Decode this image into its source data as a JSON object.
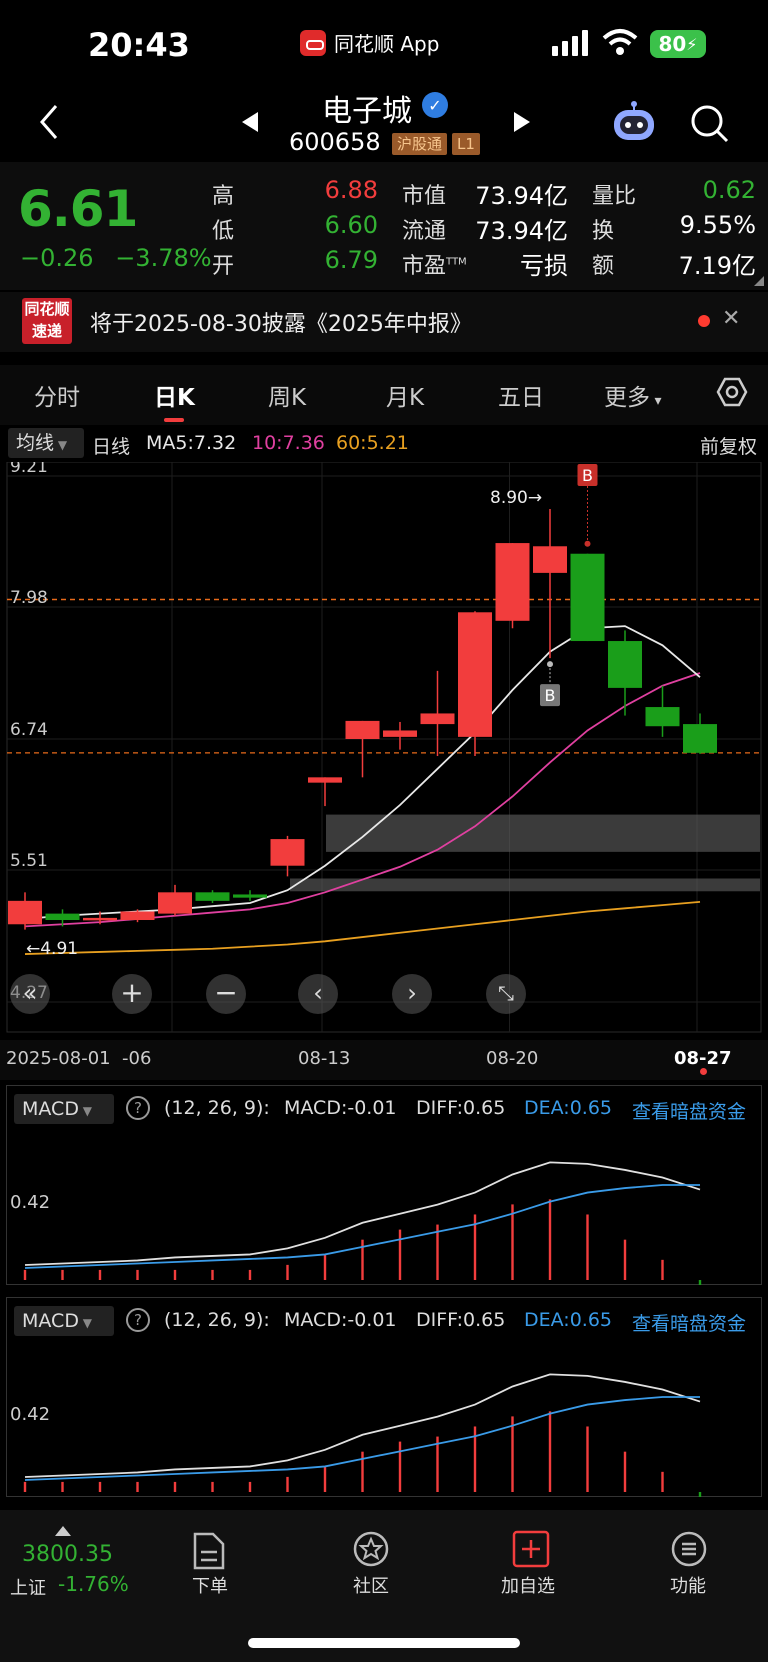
{
  "status_bar": {
    "time": "20:43",
    "app_name": "同花顺 App",
    "battery": "80"
  },
  "nav": {
    "stock_name": "电子城",
    "stock_code": "600658",
    "tag_market": "沪股通",
    "tag_level": "L1"
  },
  "quote": {
    "price": "6.61",
    "change": "−0.26",
    "change_pct": "−3.78%",
    "high_label": "高",
    "high": "6.88",
    "low_label": "低",
    "low": "6.60",
    "open_label": "开",
    "open": "6.79",
    "mktcap_label": "市值",
    "mktcap": "73.94亿",
    "float_label": "流通",
    "float": "73.94亿",
    "pe_label": "市盈",
    "pe_sup": "TTM",
    "pe": "亏损",
    "volratio_label": "量比",
    "volratio": "0.62",
    "turnover_label": "换",
    "turnover": "9.55%",
    "amount_label": "额",
    "amount": "7.19亿"
  },
  "notice": {
    "logo_line1": "同花顺",
    "logo_line2": "速递",
    "text": "将于2025-08-30披露《2025年中报》"
  },
  "tabs": [
    "分时",
    "日K",
    "周K",
    "月K",
    "五日",
    "更多"
  ],
  "active_tab": "日K",
  "chart_header": {
    "indicator": "均线",
    "period": "日线",
    "ma5": "MA5:7.32",
    "ma10": "10:7.36",
    "ma60": "60:5.21",
    "adjust": "前复权"
  },
  "chart_data": {
    "type": "candlestick",
    "y_ticks": [
      "9.21",
      "7.98",
      "6.74",
      "5.51",
      "4.27"
    ],
    "ylim": [
      4.27,
      9.21
    ],
    "x_ticks": [
      "2025-08-01",
      "-06",
      "08-13",
      "08-20",
      "08-27"
    ],
    "max_label": "8.90→",
    "min_label": "4.91",
    "buy_marker": "B",
    "colors": {
      "up": "#f23d3d",
      "down": "#1a9e1a",
      "ma5": "#e8e8e8",
      "ma10": "#e040a0",
      "ma60": "#e8a020"
    },
    "candles": [
      {
        "o": 5.0,
        "h": 5.3,
        "l": 4.95,
        "c": 5.22
      },
      {
        "o": 5.1,
        "h": 5.14,
        "l": 4.98,
        "c": 5.04
      },
      {
        "o": 5.06,
        "h": 5.12,
        "l": 5.0,
        "c": 5.06
      },
      {
        "o": 5.04,
        "h": 5.14,
        "l": 5.02,
        "c": 5.12
      },
      {
        "o": 5.1,
        "h": 5.37,
        "l": 5.08,
        "c": 5.3
      },
      {
        "o": 5.3,
        "h": 5.32,
        "l": 5.2,
        "c": 5.22
      },
      {
        "o": 5.28,
        "h": 5.32,
        "l": 5.22,
        "c": 5.25
      },
      {
        "o": 5.55,
        "h": 5.83,
        "l": 5.45,
        "c": 5.8
      },
      {
        "o": 6.33,
        "h": 6.38,
        "l": 6.11,
        "c": 6.38
      },
      {
        "o": 6.74,
        "h": 6.91,
        "l": 6.38,
        "c": 6.91
      },
      {
        "o": 6.76,
        "h": 6.9,
        "l": 6.64,
        "c": 6.82
      },
      {
        "o": 6.88,
        "h": 7.38,
        "l": 6.58,
        "c": 6.98
      },
      {
        "o": 6.76,
        "h": 7.94,
        "l": 6.58,
        "c": 7.93
      },
      {
        "o": 7.85,
        "h": 8.58,
        "l": 7.78,
        "c": 8.58
      },
      {
        "o": 8.3,
        "h": 8.9,
        "l": 7.5,
        "c": 8.55
      },
      {
        "o": 8.48,
        "h": 8.48,
        "l": 7.66,
        "c": 7.66
      },
      {
        "o": 7.66,
        "h": 7.76,
        "l": 6.96,
        "c": 7.22
      },
      {
        "o": 7.04,
        "h": 7.24,
        "l": 6.76,
        "c": 6.86
      },
      {
        "o": 6.88,
        "h": 6.98,
        "l": 6.6,
        "c": 6.61
      }
    ],
    "ma5": [
      5.05,
      5.08,
      5.1,
      5.12,
      5.14,
      5.17,
      5.2,
      5.32,
      5.55,
      5.82,
      6.12,
      6.46,
      6.8,
      7.2,
      7.56,
      7.78,
      7.8,
      7.62,
      7.32
    ],
    "ma10": [
      4.98,
      5.0,
      5.02,
      5.05,
      5.08,
      5.11,
      5.14,
      5.2,
      5.3,
      5.42,
      5.54,
      5.7,
      5.92,
      6.2,
      6.52,
      6.82,
      7.05,
      7.24,
      7.36
    ],
    "ma60": [
      4.72,
      4.73,
      4.74,
      4.75,
      4.76,
      4.77,
      4.79,
      4.81,
      4.84,
      4.88,
      4.92,
      4.96,
      5.0,
      5.04,
      5.08,
      5.12,
      5.15,
      5.18,
      5.21
    ]
  },
  "macd": {
    "label": "MACD",
    "params": "(12, 26, 9):",
    "macd_value": "MACD:-0.01",
    "diff_value": "DIFF:0.65",
    "dea_value": "DEA:0.65",
    "link": "查看暗盘资金",
    "y_tick": "0.42",
    "bars": [
      0.02,
      0.02,
      0.02,
      0.02,
      0.02,
      0.02,
      0.02,
      0.03,
      0.05,
      0.08,
      0.1,
      0.11,
      0.13,
      0.15,
      0.16,
      0.13,
      0.08,
      0.04,
      -0.01
    ],
    "diff": [
      0.02,
      0.03,
      0.04,
      0.05,
      0.07,
      0.08,
      0.09,
      0.13,
      0.2,
      0.3,
      0.36,
      0.42,
      0.5,
      0.62,
      0.7,
      0.69,
      0.65,
      0.6,
      0.52
    ],
    "dea": [
      0.0,
      0.01,
      0.02,
      0.03,
      0.04,
      0.05,
      0.06,
      0.07,
      0.09,
      0.14,
      0.19,
      0.24,
      0.29,
      0.36,
      0.44,
      0.5,
      0.53,
      0.55,
      0.55
    ]
  },
  "bottom_bar": {
    "index_value": "3800.35",
    "index_name": "上证",
    "index_change": "-1.76%",
    "items": [
      "下单",
      "社区",
      "加自选",
      "功能"
    ]
  }
}
